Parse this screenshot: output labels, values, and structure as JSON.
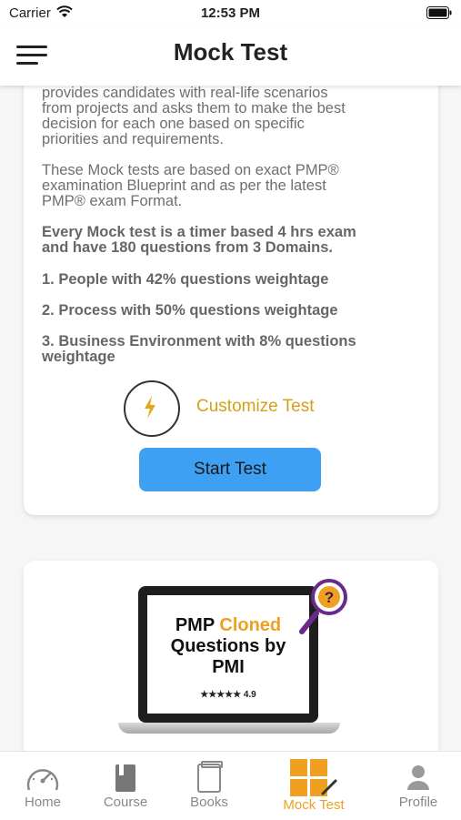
{
  "status": {
    "carrier": "Carrier",
    "time": "12:53 PM"
  },
  "nav": {
    "title": "Mock Test"
  },
  "card": {
    "para1_cut": "provides candidates with real-life scenarios",
    "para1": [
      "from projects and asks them to make the best",
      "decision for each one based on specific",
      "priorities and requirements."
    ],
    "para2": [
      "These Mock tests are based on exact PMP®",
      "examination Blueprint and as per the latest",
      "PMP® exam Format."
    ],
    "para3": [
      "Every Mock test is a timer based 4 hrs exam",
      "and have 180 questions from 3 Domains."
    ],
    "domain1": "1. People with 42% questions weightage",
    "domain2": "2. Process with 50% questions weightage",
    "domain3": [
      "3. Business Environment with 8% questions",
      "weightage"
    ],
    "customize_label": "Customize Test",
    "start_label": "Start Test"
  },
  "promo": {
    "title_line1_a": "PMP ",
    "title_line1_b": "Cloned",
    "title_line2": "Questions by",
    "title_line3": "PMI",
    "stars": "★★★★★",
    "rating": "4.9"
  },
  "tabs": [
    {
      "label": "Home",
      "icon": "speedometer-icon"
    },
    {
      "label": "Course",
      "icon": "book-icon"
    },
    {
      "label": "Books",
      "icon": "books-icon"
    },
    {
      "label": "Mock Test",
      "icon": "grid-pencil-icon"
    },
    {
      "label": "Profile",
      "icon": "person-icon"
    }
  ],
  "colors": {
    "accent": "#f0a020",
    "button": "#3da0f2",
    "text_gray": "#6f6f6f"
  }
}
